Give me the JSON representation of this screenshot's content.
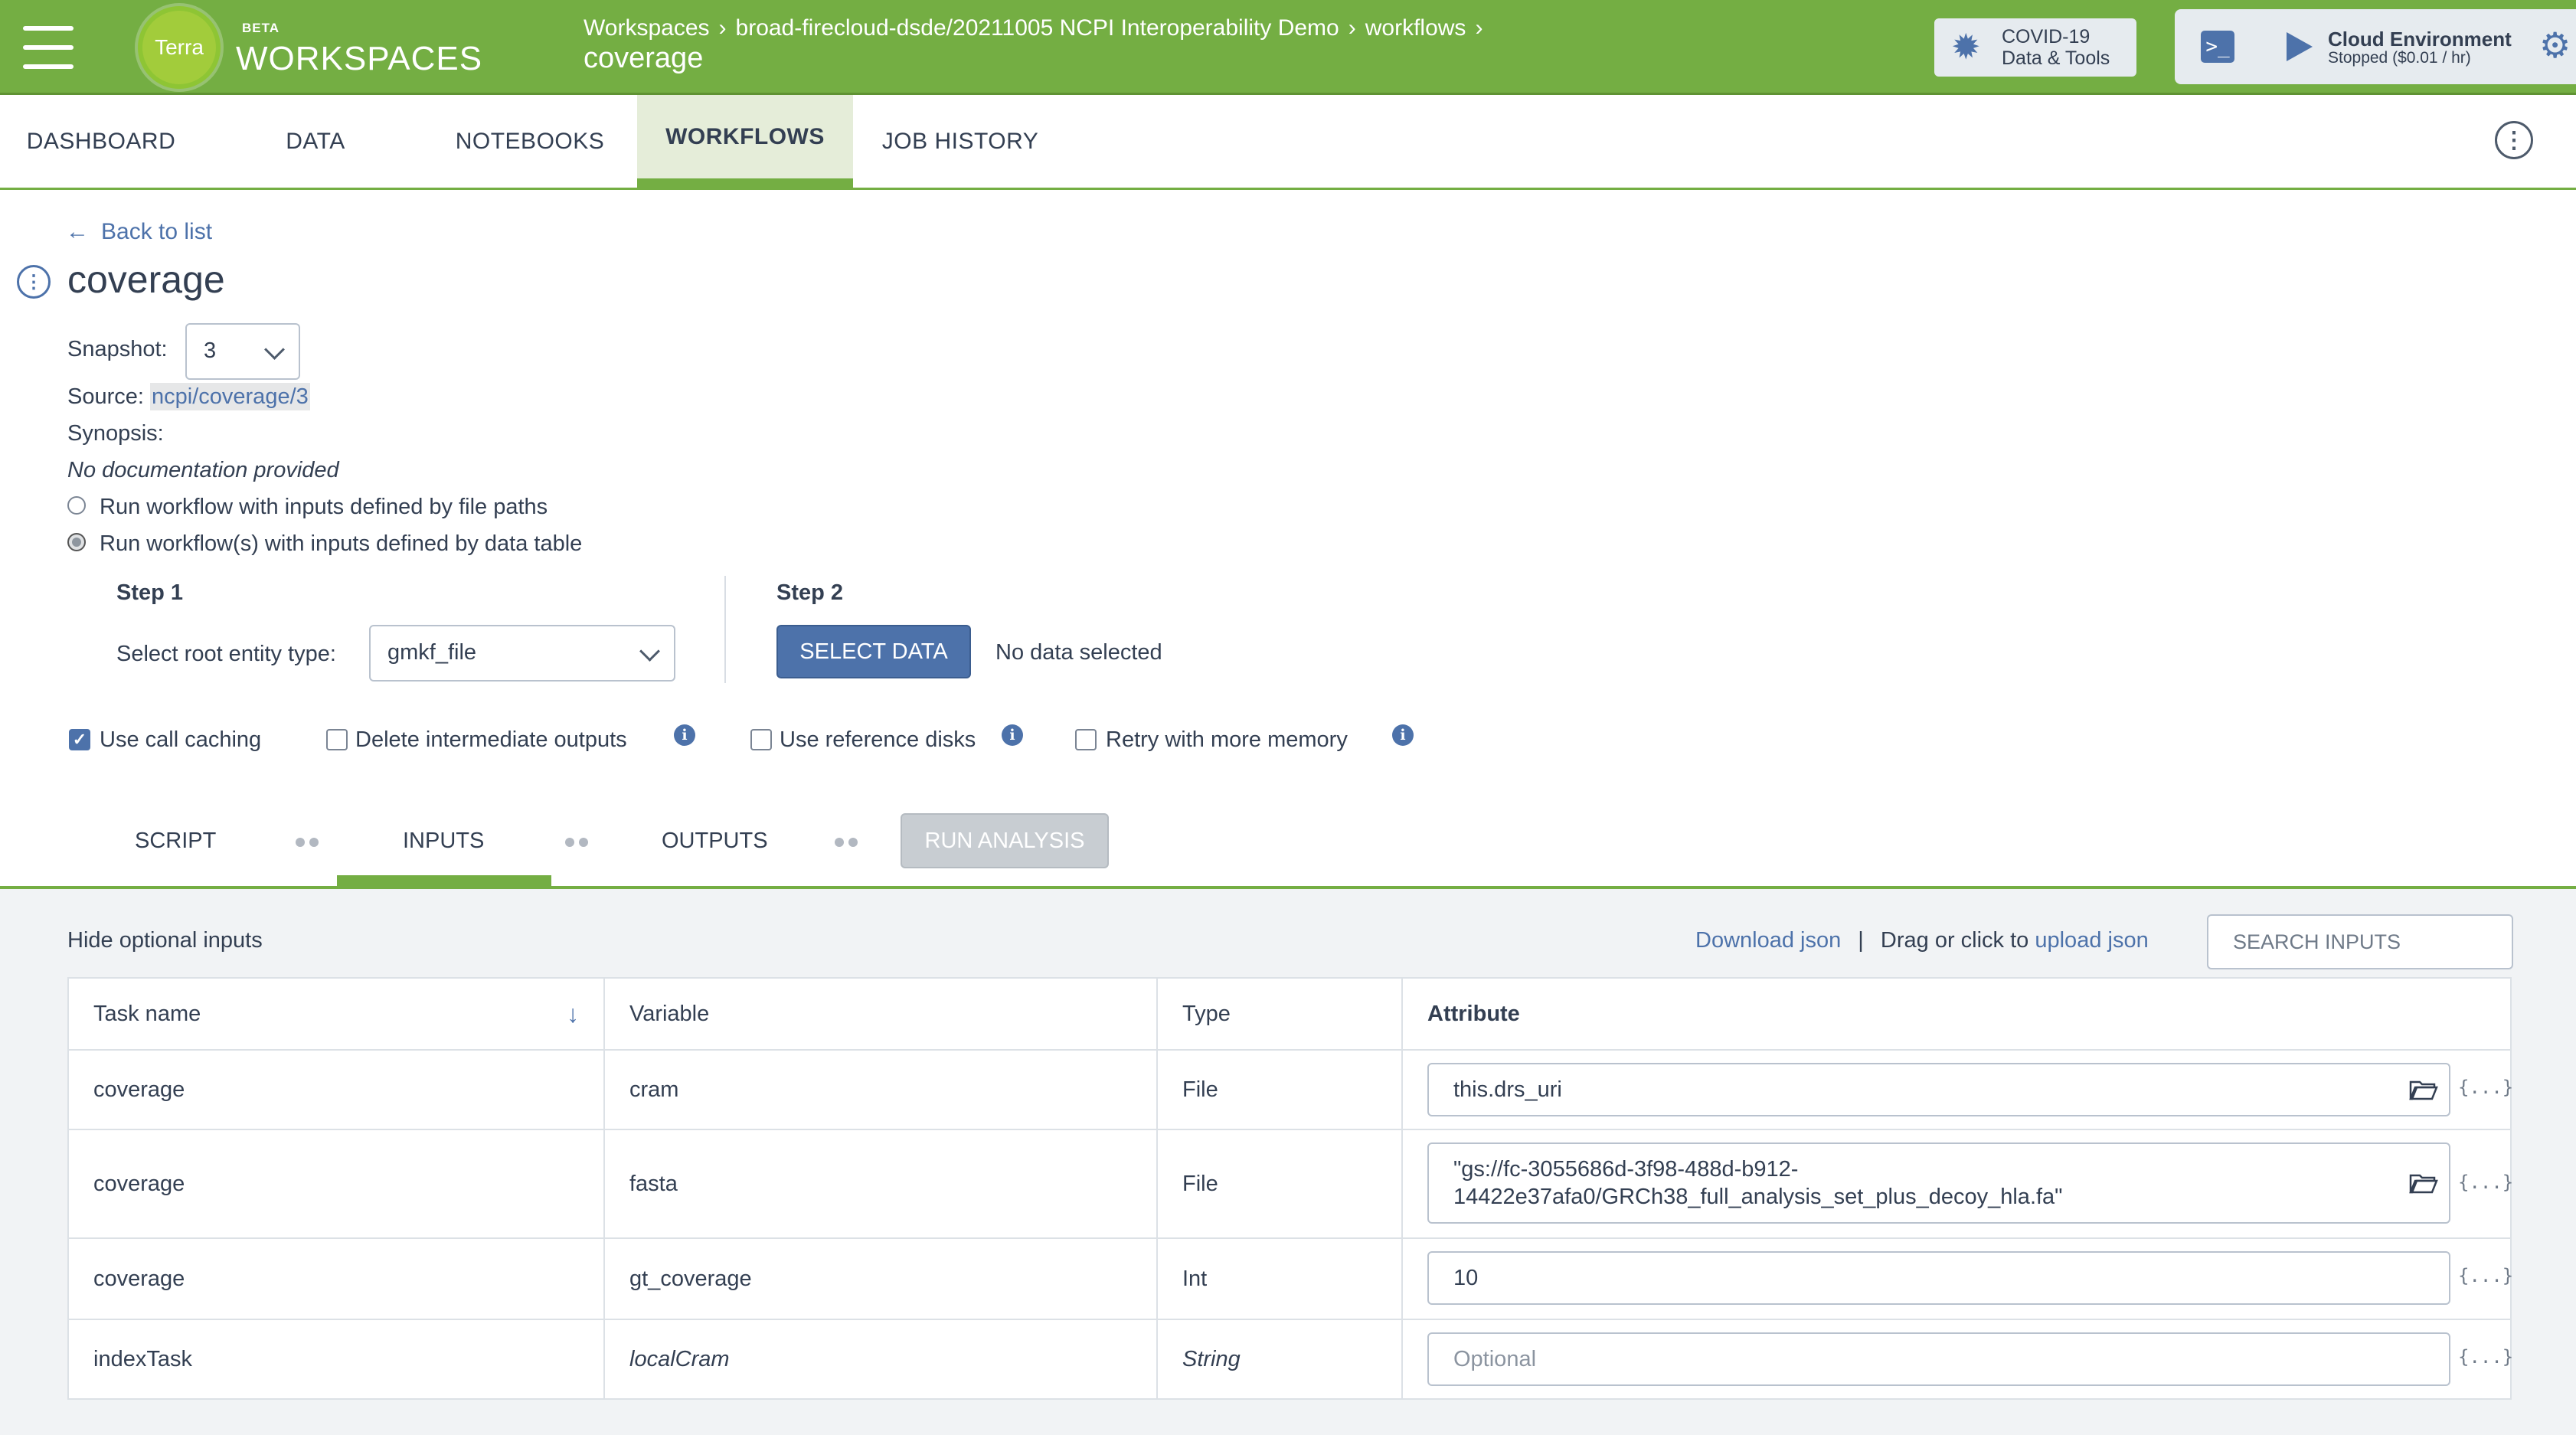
{
  "header": {
    "logo_text": "Terra",
    "beta": "BETA",
    "section": "WORKSPACES",
    "breadcrumb": [
      "Workspaces",
      "broad-firecloud-dsde/20211005 NCPI Interoperability Demo",
      "workflows"
    ],
    "breadcrumb_sep": "›",
    "page_name": "coverage",
    "covid": {
      "line1": "COVID-19",
      "line2": "Data & Tools"
    },
    "cloud": {
      "title": "Cloud Environment",
      "status": "Stopped ($0.01 / hr)"
    }
  },
  "tabs": [
    {
      "label": "DASHBOARD",
      "active": false
    },
    {
      "label": "DATA",
      "active": false
    },
    {
      "label": "NOTEBOOKS",
      "active": false
    },
    {
      "label": "WORKFLOWS",
      "active": true
    },
    {
      "label": "JOB HISTORY",
      "active": false
    }
  ],
  "workflow": {
    "back_label": "Back to list",
    "title": "coverage",
    "snapshot_label": "Snapshot:",
    "snapshot_value": "3",
    "source_label": "Source:",
    "source_link": "ncpi/coverage/3",
    "synopsis_label": "Synopsis:",
    "documentation": "No documentation provided",
    "radio_file_paths": "Run workflow with inputs defined by file paths",
    "radio_data_table": "Run workflow(s) with inputs defined by data table",
    "radio_selected": "data_table"
  },
  "steps": {
    "step1_title": "Step 1",
    "root_entity_label": "Select root entity type:",
    "root_entity_value": "gmkf_file",
    "step2_title": "Step 2",
    "select_data_button": "SELECT DATA",
    "no_data": "No data selected"
  },
  "options": [
    {
      "label": "Use call caching",
      "checked": true,
      "info": false
    },
    {
      "label": "Delete intermediate outputs",
      "checked": false,
      "info": true
    },
    {
      "label": "Use reference disks",
      "checked": false,
      "info": true
    },
    {
      "label": "Retry with more memory",
      "checked": false,
      "info": true
    }
  ],
  "subtabs": {
    "script": "SCRIPT",
    "inputs": "INPUTS",
    "outputs": "OUTPUTS",
    "run": "RUN ANALYSIS",
    "active": "INPUTS"
  },
  "inputs_panel": {
    "hide_optional": "Hide optional inputs",
    "download_json": "Download json",
    "divider": "|",
    "drag_text": "Drag or click to",
    "upload_json": "upload json",
    "search_placeholder": "SEARCH INPUTS"
  },
  "table": {
    "headers": {
      "task": "Task name",
      "variable": "Variable",
      "type": "Type",
      "attribute": "Attribute"
    },
    "json_btn": "{...}",
    "rows": [
      {
        "task": "coverage",
        "variable": "cram",
        "type": "File",
        "attribute": "this.drs_uri",
        "optional": false
      },
      {
        "task": "coverage",
        "variable": "fasta",
        "type": "File",
        "attribute_line1": "\"gs://fc-3055686d-3f98-488d-b912-",
        "attribute_line2": "14422e37afa0/GRCh38_full_analysis_set_plus_decoy_hla.fa\"",
        "optional": false
      },
      {
        "task": "coverage",
        "variable": "gt_coverage",
        "type": "Int",
        "attribute": "10",
        "optional": false
      },
      {
        "task": "indexTask",
        "variable": "localCram",
        "type": "String",
        "attribute_placeholder": "Optional",
        "optional": true
      }
    ]
  },
  "colors": {
    "header_green": "#74ae43",
    "link_blue": "#4d72aa",
    "text": "#333f52"
  }
}
